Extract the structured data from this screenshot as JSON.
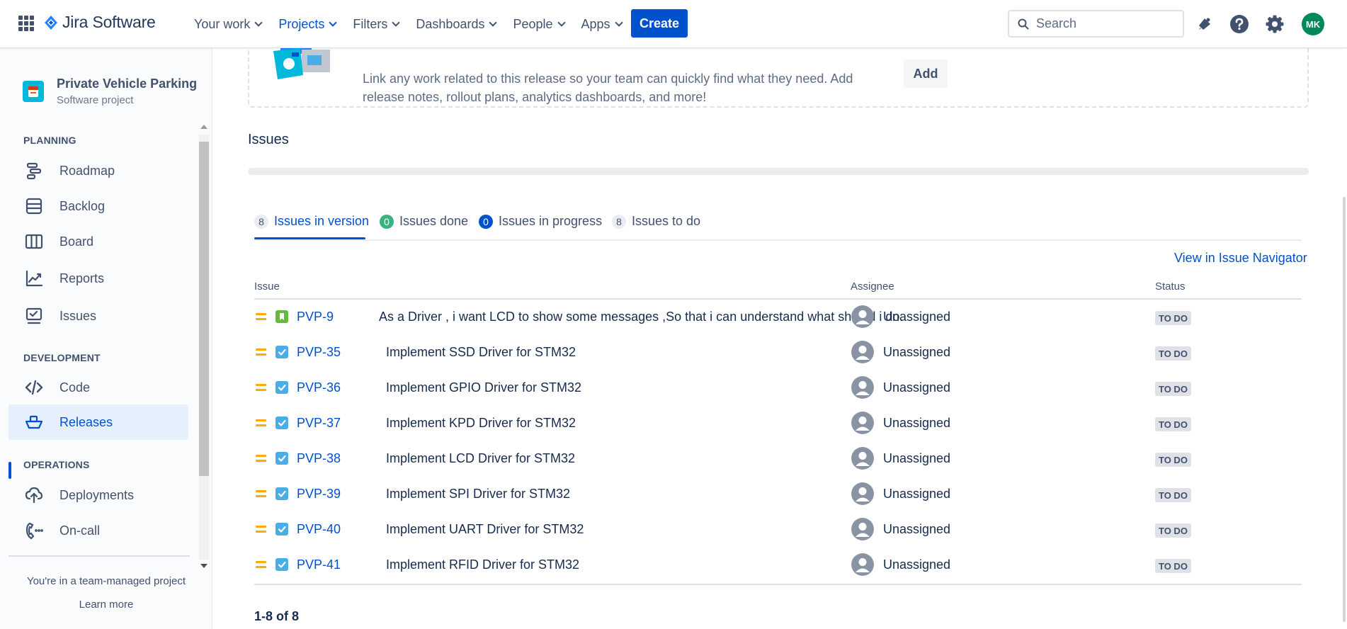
{
  "topnav": {
    "product": "Jira Software",
    "items": [
      {
        "label": "Your work"
      },
      {
        "label": "Projects"
      },
      {
        "label": "Filters"
      },
      {
        "label": "Dashboards"
      },
      {
        "label": "People"
      },
      {
        "label": "Apps"
      }
    ],
    "active_item": "Projects",
    "create_label": "Create",
    "search_placeholder": "Search",
    "avatar_initials": "MK",
    "colors": {
      "primary": "#0052cc",
      "avatar": "#00875a"
    }
  },
  "sidebar": {
    "project_name": "Private Vehicle Parking",
    "project_type": "Software project",
    "sections": [
      {
        "title": "PLANNING",
        "items": [
          {
            "label": "Roadmap",
            "icon": "roadmap-icon"
          },
          {
            "label": "Backlog",
            "icon": "backlog-icon"
          },
          {
            "label": "Board",
            "icon": "board-icon"
          },
          {
            "label": "Reports",
            "icon": "reports-icon"
          },
          {
            "label": "Issues",
            "icon": "issues-icon"
          }
        ]
      },
      {
        "title": "DEVELOPMENT",
        "items": [
          {
            "label": "Code",
            "icon": "code-icon"
          },
          {
            "label": "Releases",
            "icon": "releases-icon"
          }
        ]
      },
      {
        "title": "OPERATIONS",
        "items": [
          {
            "label": "Deployments",
            "icon": "deployments-icon"
          },
          {
            "label": "On-call",
            "icon": "on-call-icon"
          }
        ]
      }
    ],
    "active_item": "Releases",
    "footer_text": "You're in a team-managed project",
    "learn_more": "Learn more"
  },
  "release_card": {
    "text": "Link any work related to this release so your team can quickly find what they need. Add release notes, rollout plans, analytics dashboards, and more!",
    "add_label": "Add"
  },
  "issues": {
    "title": "Issues",
    "tabs": [
      {
        "count": "8",
        "label": "Issues in version"
      },
      {
        "count": "0",
        "label": "Issues done"
      },
      {
        "count": "0",
        "label": "Issues in progress"
      },
      {
        "count": "8",
        "label": "Issues to do"
      }
    ],
    "active_tab": "Issues in version",
    "view_in_navigator": "View in Issue Navigator",
    "columns": {
      "issue": "Issue",
      "assignee": "Assignee",
      "status": "Status"
    },
    "rows": [
      {
        "key": "PVP-9",
        "type": "story",
        "summary": "As a Driver , i want LCD to show some messages ,So that i can understand what should i do.",
        "assignee": "Unassigned",
        "status": "TO DO"
      },
      {
        "key": "PVP-35",
        "type": "task",
        "summary": "Implement SSD Driver for STM32",
        "assignee": "Unassigned",
        "status": "TO DO"
      },
      {
        "key": "PVP-36",
        "type": "task",
        "summary": "Implement GPIO Driver for STM32",
        "assignee": "Unassigned",
        "status": "TO DO"
      },
      {
        "key": "PVP-37",
        "type": "task",
        "summary": "Implement KPD Driver for STM32",
        "assignee": "Unassigned",
        "status": "TO DO"
      },
      {
        "key": "PVP-38",
        "type": "task",
        "summary": "Implement LCD Driver for STM32",
        "assignee": "Unassigned",
        "status": "TO DO"
      },
      {
        "key": "PVP-39",
        "type": "task",
        "summary": "Implement SPI Driver for STM32",
        "assignee": "Unassigned",
        "status": "TO DO"
      },
      {
        "key": "PVP-40",
        "type": "task",
        "summary": "Implement UART Driver for STM32",
        "assignee": "Unassigned",
        "status": "TO DO"
      },
      {
        "key": "PVP-41",
        "type": "task",
        "summary": "Implement RFID Driver for STM32",
        "assignee": "Unassigned",
        "status": "TO DO"
      }
    ],
    "pagination": "1-8 of 8"
  }
}
